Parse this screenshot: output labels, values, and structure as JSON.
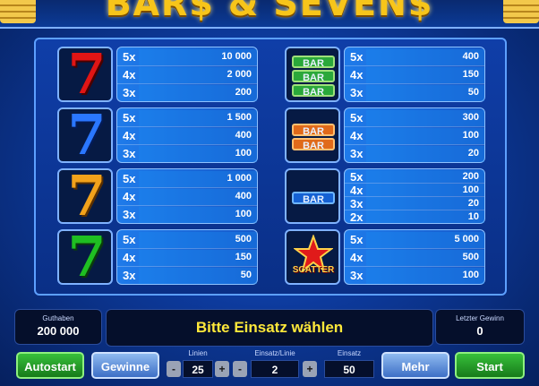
{
  "title": "BAR$ & SEVEN$",
  "left_column": [
    {
      "symbol": "seven-red",
      "pays": [
        {
          "mult": "5x",
          "val": "10 000"
        },
        {
          "mult": "4x",
          "val": "2 000"
        },
        {
          "mult": "3x",
          "val": "200"
        }
      ]
    },
    {
      "symbol": "seven-blue",
      "pays": [
        {
          "mult": "5x",
          "val": "1 500"
        },
        {
          "mult": "4x",
          "val": "400"
        },
        {
          "mult": "3x",
          "val": "100"
        }
      ]
    },
    {
      "symbol": "seven-orange",
      "pays": [
        {
          "mult": "5x",
          "val": "1 000"
        },
        {
          "mult": "4x",
          "val": "400"
        },
        {
          "mult": "3x",
          "val": "100"
        }
      ]
    },
    {
      "symbol": "seven-green",
      "pays": [
        {
          "mult": "5x",
          "val": "500"
        },
        {
          "mult": "4x",
          "val": "150"
        },
        {
          "mult": "3x",
          "val": "50"
        }
      ]
    }
  ],
  "right_column": [
    {
      "symbol": "triple-bar-green",
      "pays": [
        {
          "mult": "5x",
          "val": "400"
        },
        {
          "mult": "4x",
          "val": "150"
        },
        {
          "mult": "3x",
          "val": "50"
        }
      ]
    },
    {
      "symbol": "double-bar-orange",
      "pays": [
        {
          "mult": "5x",
          "val": "300"
        },
        {
          "mult": "4x",
          "val": "100"
        },
        {
          "mult": "3x",
          "val": "20"
        }
      ]
    },
    {
      "symbol": "single-bar-blue",
      "pays": [
        {
          "mult": "5x",
          "val": "200"
        },
        {
          "mult": "4x",
          "val": "100"
        },
        {
          "mult": "3x",
          "val": "20"
        },
        {
          "mult": "2x",
          "val": "10"
        }
      ]
    },
    {
      "symbol": "scatter-star",
      "pays": [
        {
          "mult": "5x",
          "val": "5 000"
        },
        {
          "mult": "4x",
          "val": "500"
        },
        {
          "mult": "3x",
          "val": "100"
        }
      ]
    }
  ],
  "symbol_text": {
    "bar": "BAR",
    "scatter": "SCATTER"
  },
  "status": {
    "balance_label": "Guthaben",
    "balance_value": "200 000",
    "message": "Bitte Einsatz wählen",
    "last_win_label": "Letzter Gewinn",
    "last_win_value": "0"
  },
  "controls": {
    "autostart": "Autostart",
    "gamble": "Gewinne",
    "lines_label": "Linien",
    "lines_value": "25",
    "bet_line_label": "Einsatz/Linie",
    "bet_line_value": "2",
    "bet_label": "Einsatz",
    "bet_value": "50",
    "more": "Mehr",
    "start": "Start",
    "minus": "-",
    "plus": "+"
  },
  "colors": {
    "accent_gold": "#f7c51a",
    "message_yellow": "#ffe83a",
    "button_green": "#1fa024",
    "panel_blue": "#1558c9"
  }
}
